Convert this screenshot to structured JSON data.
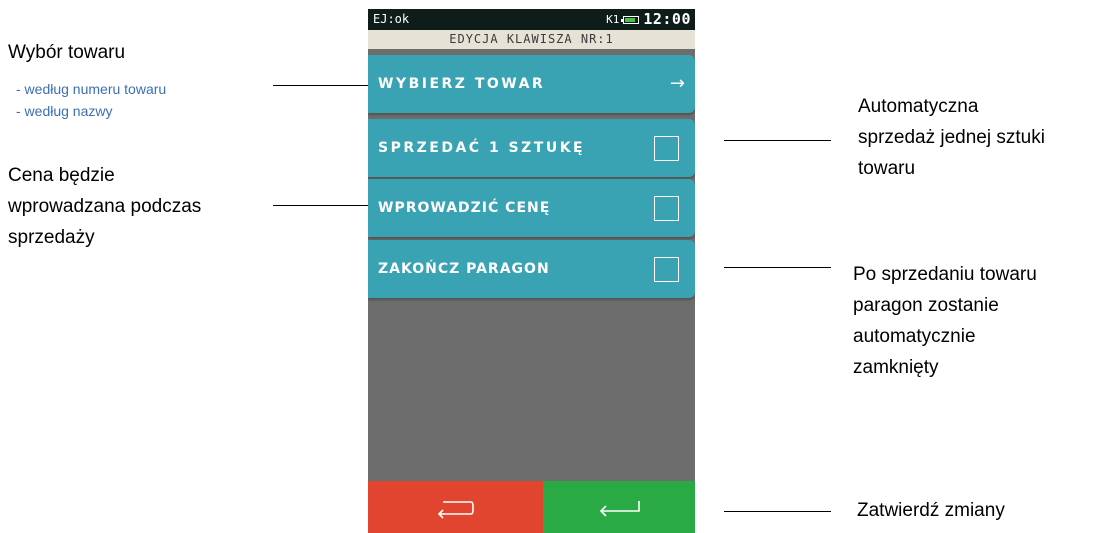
{
  "status": {
    "left": "EJ:ok",
    "printer": "K1",
    "time": "12:00",
    "battery_level": 0.8
  },
  "screen_title": "EDYCJA KLAWISZA NR:1",
  "menu": {
    "items": [
      {
        "label": "WYBIERZ TOWAR",
        "control": "arrow",
        "icon": "arrow-right-icon"
      },
      {
        "label": "SPRZEDAĆ 1 SZTUKĘ",
        "control": "checkbox",
        "checked": false
      },
      {
        "label": "WPROWADZIĆ CENĘ",
        "control": "checkbox",
        "checked": false
      },
      {
        "label": "ZAKOŃCZ PARAGON",
        "control": "checkbox",
        "checked": false
      }
    ]
  },
  "buttons": {
    "back": {
      "icon": "back-return-icon",
      "color": "#e14530"
    },
    "confirm": {
      "icon": "enter-return-icon",
      "color": "#2aaa45"
    }
  },
  "colors": {
    "menu_item": "#3aa3b3",
    "screen_background": "#6d6d6d",
    "status_bar": "#0f1d1a",
    "title_bar": "#e6e2d6",
    "annotation_option": "#3c6fb5"
  },
  "annotations": {
    "select_product": {
      "title": "Wybór towaru",
      "options": [
        "- według numeru towaru",
        "- według nazwy"
      ]
    },
    "price": {
      "lines": [
        "Cena będzie",
        "wprowadzana podczas",
        "sprzedaży"
      ]
    },
    "auto_sell": {
      "lines": [
        "Automatyczna",
        "sprzedaż jednej sztuki",
        "towaru"
      ]
    },
    "close_receipt": {
      "lines": [
        "Po sprzedaniu towaru",
        "paragon zostanie",
        "automatycznie",
        "zamknięty"
      ]
    },
    "confirm": {
      "text": "Zatwierdź zmiany"
    }
  }
}
